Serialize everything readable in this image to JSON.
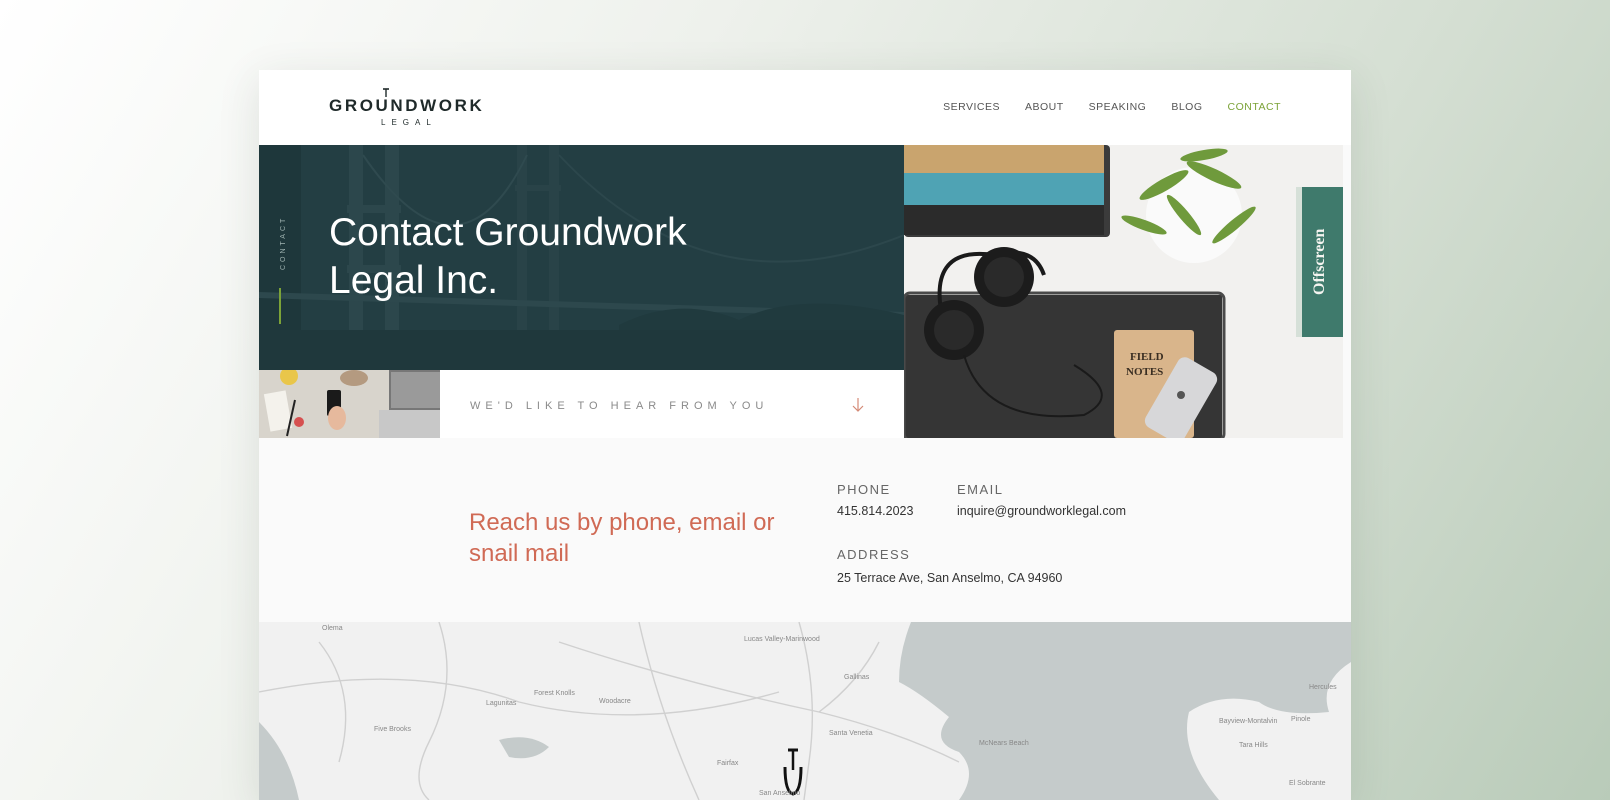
{
  "header": {
    "logo_word": "GROUNDWORK",
    "logo_sub": "LEGAL",
    "nav": [
      {
        "label": "SERVICES",
        "active": false
      },
      {
        "label": "ABOUT",
        "active": false
      },
      {
        "label": "SPEAKING",
        "active": false
      },
      {
        "label": "BLOG",
        "active": false
      },
      {
        "label": "CONTACT",
        "active": true
      }
    ]
  },
  "hero": {
    "side_label": "CONTACT",
    "title": "Contact Groundwork Legal Inc."
  },
  "photo_right": {
    "notebook_text": "FIELD NOTES",
    "book_spine": "Offscreen"
  },
  "hear": {
    "text": "WE'D LIKE TO HEAR FROM YOU",
    "arrow_icon": "arrow-down-icon"
  },
  "contact": {
    "heading": "Reach us by phone, email or snail mail",
    "phone_label": "PHONE",
    "phone": "415.814.2023",
    "email_label": "EMAIL",
    "email": "inquire@groundworklegal.com",
    "address_label": "ADDRESS",
    "address": "25 Terrace Ave, San Anselmo, CA 94960"
  },
  "map": {
    "places": [
      "Olema",
      "Lucas Valley-Marinwood",
      "Forest Knolls",
      "Lagunitas",
      "Woodacre",
      "Five Brooks",
      "Gallinas",
      "Santa Venetia",
      "McNears Beach",
      "Fairfax",
      "Hercules",
      "Bayview-Montalvin",
      "Pinole",
      "Tara Hills",
      "El Sobrante",
      "San Anselmo"
    ]
  },
  "colors": {
    "accent_green": "#7ca338",
    "hero_bg": "#233e43",
    "heading_coral": "#d06a55"
  }
}
